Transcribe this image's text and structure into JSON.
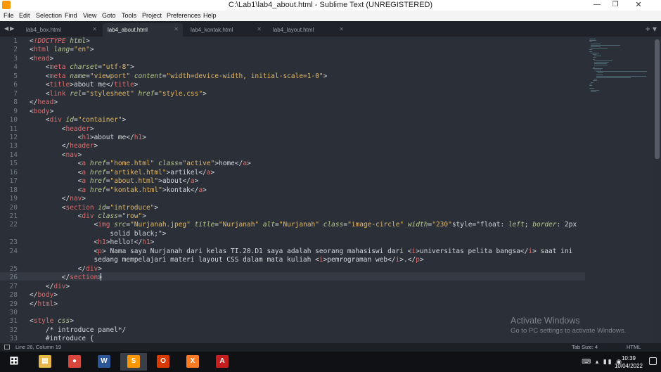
{
  "window": {
    "title": "C:\\Lab1\\lab4_about.html - Sublime Text (UNREGISTERED)"
  },
  "menu": [
    "File",
    "Edit",
    "Selection",
    "Find",
    "View",
    "Goto",
    "Tools",
    "Project",
    "Preferences",
    "Help"
  ],
  "tabs": [
    {
      "label": "lab4_box.html",
      "active": false
    },
    {
      "label": "lab4_about.html",
      "active": true
    },
    {
      "label": "lab4_kontak.html",
      "active": false
    },
    {
      "label": "lab4_layout.html",
      "active": false
    }
  ],
  "editor": {
    "line_numbers": [
      "1",
      "2",
      "3",
      "4",
      "5",
      "6",
      "7",
      "8",
      "9",
      "10",
      "11",
      "12",
      "13",
      "14",
      "15",
      "16",
      "17",
      "18",
      "19",
      "20",
      "21",
      "22",
      "",
      "23",
      "24",
      "",
      "25",
      "26",
      "27",
      "28",
      "29",
      "30",
      "31",
      "32",
      "33"
    ],
    "lines": [
      "<!DOCTYPE html>",
      "<html lang=\"en\">",
      "<head>",
      "    <meta charset=\"utf-8\">",
      "    <meta name=\"viewport\" content=\"width=device-width, initial-scale=1-0\">",
      "    <title>about me</title>",
      "    <link rel=\"stylesheet\" href=\"style.css\">",
      "</head>",
      "<body>",
      "    <div id=\"container\">",
      "        <header>",
      "            <h1>about me</h1>",
      "        </header>",
      "        <nav>",
      "            <a href=\"home.html\" class=\"active\">home</a>",
      "            <a href=\"artikel.html\">artikel</a>",
      "            <a href=\"about.html\">about</a>",
      "            <a href=\"kontak.html\">kontak</a>",
      "        </nav>",
      "        <section id=\"introduce\">",
      "            <div class=\"row\">",
      "                <img src=\"Nurjanah.jpeg\" title=\"Nurjanah\" alt=\"Nurjanah\" class=\"image-circle\" width=\"230\"style=\"float: left; border: 2px",
      "                    solid black;\">",
      "                <h1>hello!</h1>",
      "                <p> Nama saya Nurjanah dari kelas TI.20.D1 saya adalah seorang mahasiswi dari <i>universitas pelita bangsa</i> saat ini",
      "                sedang mempelajari materi layout CSS dalam mata kuliah <i>pemrograman web</i>.</p>",
      "            </div>",
      "        </section>",
      "    </div>",
      "</body>",
      "</html>",
      "",
      "<style css>",
      "    /* introduce panel*/",
      "    #introduce {"
    ]
  },
  "status": {
    "position": "Line 26, Column 19",
    "tab_size": "Tab Size: 4",
    "syntax": "HTML"
  },
  "watermark": {
    "line1": "Activate Windows",
    "line2": "Go to PC settings to activate Windows."
  },
  "taskbar": {
    "apps": [
      {
        "icon": "windows-start-icon",
        "color": "#1e90ff"
      },
      {
        "icon": "file-explorer-icon",
        "color": "#e8b84a"
      },
      {
        "icon": "chrome-icon",
        "color": "#d9463b"
      },
      {
        "icon": "word-icon",
        "color": "#2b5797"
      },
      {
        "icon": "sublime-text-icon",
        "color": "#ff9800"
      },
      {
        "icon": "office-icon",
        "color": "#d83b01"
      },
      {
        "icon": "xampp-icon",
        "color": "#fb7a24"
      },
      {
        "icon": "acrobat-icon",
        "color": "#c41e1e"
      }
    ],
    "time": "10:39",
    "date": "10/04/2022"
  },
  "colors": {
    "tag": "#e06a6a",
    "attr": "#b7c98e",
    "string": "#e0b86a",
    "background": "#2b3038"
  }
}
